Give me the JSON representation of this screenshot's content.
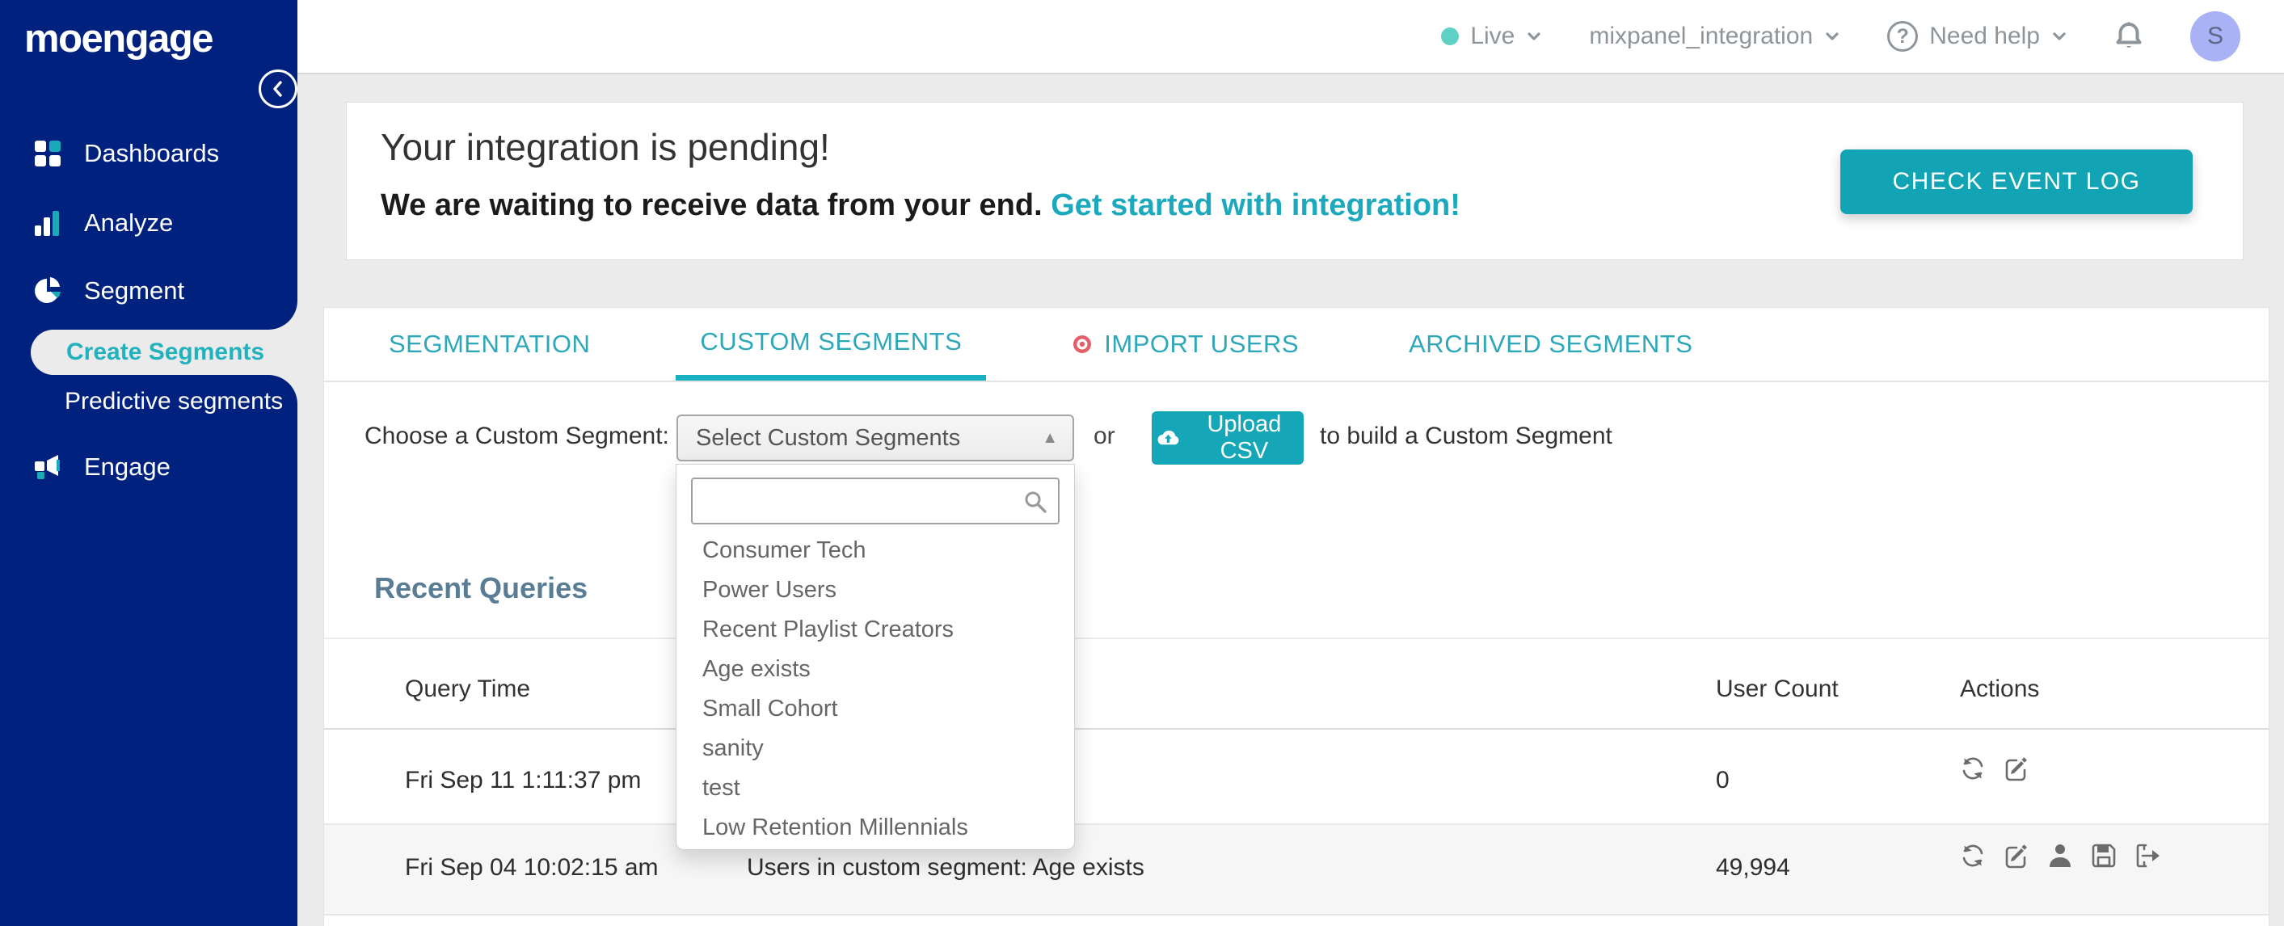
{
  "brand": {
    "logo_text": "moengage"
  },
  "topbar": {
    "env_label": "Live",
    "project_name": "mixpanel_integration",
    "help_label": "Need help",
    "avatar_initial": "S"
  },
  "sidebar": {
    "items": [
      {
        "label": "Dashboards",
        "icon": "grid-icon"
      },
      {
        "label": "Analyze",
        "icon": "bar-chart-icon"
      },
      {
        "label": "Segment",
        "icon": "pie-chart-icon"
      },
      {
        "label": "Engage",
        "icon": "megaphone-icon"
      }
    ],
    "active_subitem": "Create Segments",
    "subitems": [
      {
        "label": "Create Segments",
        "active": true
      },
      {
        "label": "Predictive segments",
        "active": false
      }
    ]
  },
  "banner": {
    "title": "Your integration is pending!",
    "subtitle": "We are waiting to receive data from your end.",
    "link_label": "Get started with integration!",
    "button_label": "CHECK EVENT LOG"
  },
  "tabs": [
    {
      "label": "SEGMENTATION",
      "active": false
    },
    {
      "label": "CUSTOM SEGMENTS",
      "active": true
    },
    {
      "label": "IMPORT USERS",
      "active": false,
      "icon": "red-target-icon"
    },
    {
      "label": "ARCHIVED SEGMENTS",
      "active": false
    }
  ],
  "chooser": {
    "label": "Choose a Custom Segment:",
    "select_value": "Select Custom Segments",
    "or_text": "or",
    "upload_button_label": "Upload CSV",
    "suffix_text": "to build a Custom Segment"
  },
  "dropdown": {
    "search_placeholder": "",
    "options": [
      "Consumer Tech",
      "Power Users",
      "Recent Playlist Creators",
      "Age exists",
      "Small Cohort",
      "sanity",
      "test",
      "Low Retention Millennials"
    ]
  },
  "recent_queries": {
    "title": "Recent Queries",
    "columns": {
      "query_time": "Query Time",
      "user_count": "User Count",
      "actions": "Actions"
    },
    "rows": [
      {
        "query_time": "Fri Sep 11 1:11:37 pm",
        "description": "",
        "user_count": "0",
        "action_icons": [
          "rerun-icon",
          "edit-icon"
        ]
      },
      {
        "query_time": "Fri Sep 04 10:02:15 am",
        "description": "Users in custom segment: Age exists",
        "user_count": "49,994",
        "action_icons": [
          "rerun-icon",
          "edit-icon",
          "user-icon",
          "save-icon",
          "export-icon"
        ]
      }
    ]
  },
  "colors": {
    "sidebar_navy": "#00227e",
    "accent_teal": "#15a6b7",
    "tab_teal": "#2da7ba",
    "live_dot_teal": "#5fd0c4",
    "avatar_periwinkle": "#a9b2f4",
    "import_users_red": "#e2606b",
    "heading_slate": "#5a7d96",
    "page_background": "#ebebeb"
  }
}
